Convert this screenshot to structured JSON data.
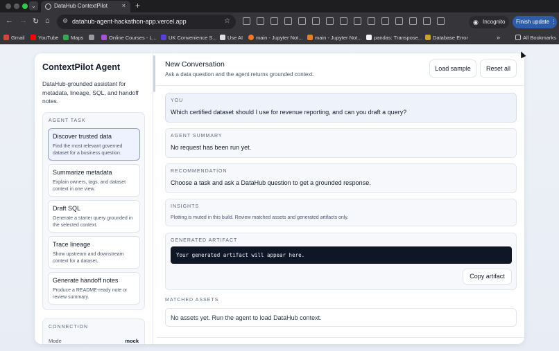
{
  "browser": {
    "tab_title": "DataHub ContextPilot",
    "tab_close": "×",
    "new_tab": "+",
    "tab_menu": "⌄",
    "url": "datahub-agent-hackathon-app.vercel.app",
    "incognito_label": "Incognito",
    "update_label": "Finish update ⋮",
    "bookmarks": [
      "Gmail",
      "YouTube",
      "Maps",
      "Online Courses - L...",
      "UK Convenience S...",
      "Use AI",
      "main - Jupyter Not...",
      "main - Jupyter Not...",
      "pandas: Transpose...",
      "Database Error"
    ],
    "bookmarks_more": "»",
    "all_bookmarks": "All Bookmarks"
  },
  "sidebar": {
    "title": "ContextPilot Agent",
    "description": "DataHub-grounded assistant for metadata, lineage, SQL, and handoff notes.",
    "task_heading": "AGENT TASK",
    "tasks": [
      {
        "title": "Discover trusted data",
        "desc": "Find the most relevant governed dataset for a business question."
      },
      {
        "title": "Summarize metadata",
        "desc": "Explain owners, tags, and dataset context in one view."
      },
      {
        "title": "Draft SQL",
        "desc": "Generate a starter query grounded in the selected context."
      },
      {
        "title": "Trace lineage",
        "desc": "Show upstream and downstream context for a dataset."
      },
      {
        "title": "Generate handoff notes",
        "desc": "Produce a README-ready note or review summary."
      }
    ],
    "connection_heading": "CONNECTION",
    "connection_mode_label": "Mode",
    "connection_mode_value": "mock"
  },
  "main": {
    "title": "New Conversation",
    "subtitle": "Ask a data question and the agent returns grounded context.",
    "load_sample": "Load sample",
    "reset_all": "Reset all",
    "you_label": "YOU",
    "you_text": "Which certified dataset should I use for revenue reporting, and can you draft a query?",
    "summary_label": "AGENT SUMMARY",
    "summary_text": "No request has been run yet.",
    "recommendation_label": "RECOMMENDATION",
    "recommendation_text": "Choose a task and ask a DataHub question to get a grounded response.",
    "insights_label": "INSIGHTS",
    "insights_text": "Plotting is muted in this build. Review matched assets and generated artifacts only.",
    "artifact_label": "GENERATED ARTIFACT",
    "artifact_text": "Your generated artifact will appear here.",
    "copy_artifact": "Copy artifact",
    "assets_label": "MATCHED ASSETS",
    "assets_text": "No assets yet. Run the agent to load DataHub context."
  },
  "colors": {
    "accent_selected_border": "#8d98dd",
    "code_background": "#0f1625",
    "update_button": "#2d5ca8"
  }
}
